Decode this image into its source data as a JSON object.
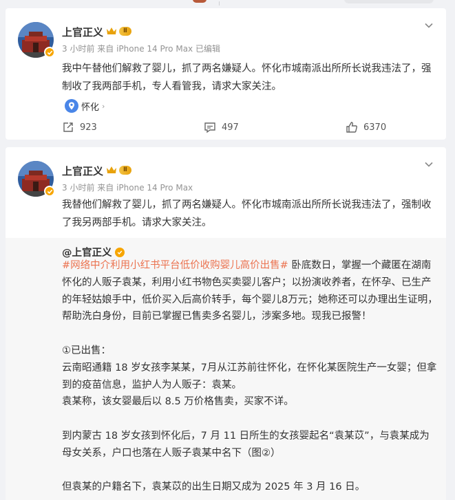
{
  "posts": [
    {
      "username": "上官正义",
      "level": "Ⅱ",
      "meta": "3 小时前  来自 iPhone 14 Pro Max 已编辑",
      "content": "我中午替他们解救了婴儿，抓了两名嫌疑人。怀化市城南派出所所长说我违法了，强制收了我两部手机，专人看管我，请求大家关注。",
      "location": "怀化",
      "location_arrow": "›",
      "repost_count": "923",
      "comment_count": "497",
      "like_count": "6370"
    },
    {
      "username": "上官正义",
      "level": "Ⅱ",
      "meta": "3 小时前  来自 iPhone 14 Pro Max",
      "content": "我替他们解救了婴儿，抓了两名嫌疑人。怀化市城南派出所所长说我违法了，强制收了我另两部手机。请求大家关注。",
      "repost": {
        "author": "@上官正义",
        "topic": "#网络中介利用小红书平台低价收购婴儿高价出售#",
        "para1": " 卧底数日，掌握一个藏匿在湖南怀化的人贩子袁某，利用小红书物色买卖婴儿客户；以扮演收养者，在怀孕、已生产的年轻姑娘手中，低价买入后高价转手，每个婴儿8万元；她称还可以办理出生证明，帮助洗白身份，目前已掌握已售卖多名婴儿，涉案多地。现我已报警！",
        "para2_title": "①已出售：",
        "para2_line1": "云南昭通籍 18 岁女孩李某某，7月从江苏前往怀化，在怀化某医院生产一女婴；但拿到的疫苗信息，监护人为人贩子：袁某。",
        "para2_line2": "袁某称，该女婴最后以 8.5 万价格售卖，买家不详。",
        "para3": "到内蒙古 18 岁女孩到怀化后，7 月 11 日所生的女孩婴起名“袁某苡”，与袁某成为母女关系，户口也落在人贩子袁某中名下（图②）",
        "para4": "但袁某的户籍名下，袁某苡的出生日期又成为 2025 年 3 月 16 日。"
      }
    }
  ],
  "icons": [
    "avatar",
    "verified-icon",
    "crown-icon",
    "more-icon",
    "location-pin-icon",
    "repost-icon",
    "comment-icon",
    "like-icon"
  ],
  "colors": {
    "topic": "#eb7350",
    "verified": "#f7a500",
    "pin": "#4a86e8",
    "card": "#ffffff",
    "background": "#f1f2f5"
  }
}
